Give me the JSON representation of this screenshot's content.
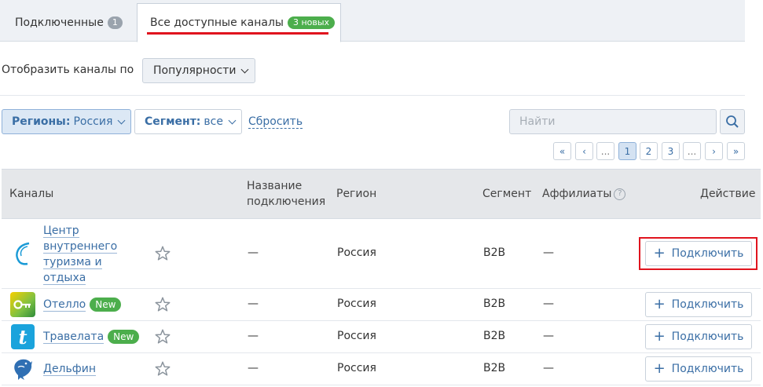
{
  "tabs": {
    "connected": {
      "label": "Подключенные",
      "count": "1"
    },
    "all": {
      "label": "Все доступные каналы",
      "badge": "3 новых"
    }
  },
  "sort": {
    "label": "Отобразить каналы по",
    "value": "Популярности"
  },
  "filters": {
    "region": {
      "key": "Регионы:",
      "value": "Россия"
    },
    "segment": {
      "key": "Сегмент:",
      "value": "все"
    },
    "reset": "Сбросить"
  },
  "search": {
    "placeholder": "Найти"
  },
  "pagination": {
    "first": "«",
    "prev": "‹",
    "dots_left": "...",
    "pages": [
      "1",
      "2",
      "3"
    ],
    "current": "1",
    "dots_right": "...",
    "next": "›",
    "last": "»"
  },
  "table": {
    "headers": {
      "channels": "Каналы",
      "connection_name": "Название подключения",
      "region": "Регион",
      "segment": "Сегмент",
      "affiliates": "Аффилиаты",
      "action": "Действие"
    },
    "rows": [
      {
        "name": "Центр внутреннего туризма и отдыха",
        "badge": "",
        "connection": "—",
        "region": "Россия",
        "segment": "B2B",
        "affiliates": "—",
        "action": "Подключить",
        "logo": "wave-logo"
      },
      {
        "name": "Отелло",
        "badge": "New",
        "connection": "—",
        "region": "Россия",
        "segment": "B2B",
        "affiliates": "—",
        "action": "Подключить",
        "logo": "key-logo"
      },
      {
        "name": "Травелата",
        "badge": "New",
        "connection": "—",
        "region": "Россия",
        "segment": "B2B",
        "affiliates": "—",
        "action": "Подключить",
        "logo": "t-logo"
      },
      {
        "name": "Дельфин",
        "badge": "",
        "connection": "—",
        "region": "Россия",
        "segment": "B2B",
        "affiliates": "—",
        "action": "Подключить",
        "logo": "dolphin-logo"
      }
    ]
  },
  "colors": {
    "accent": "#3a6ea5",
    "badge_green": "#4cae4c",
    "highlight_red": "#e0141e"
  }
}
